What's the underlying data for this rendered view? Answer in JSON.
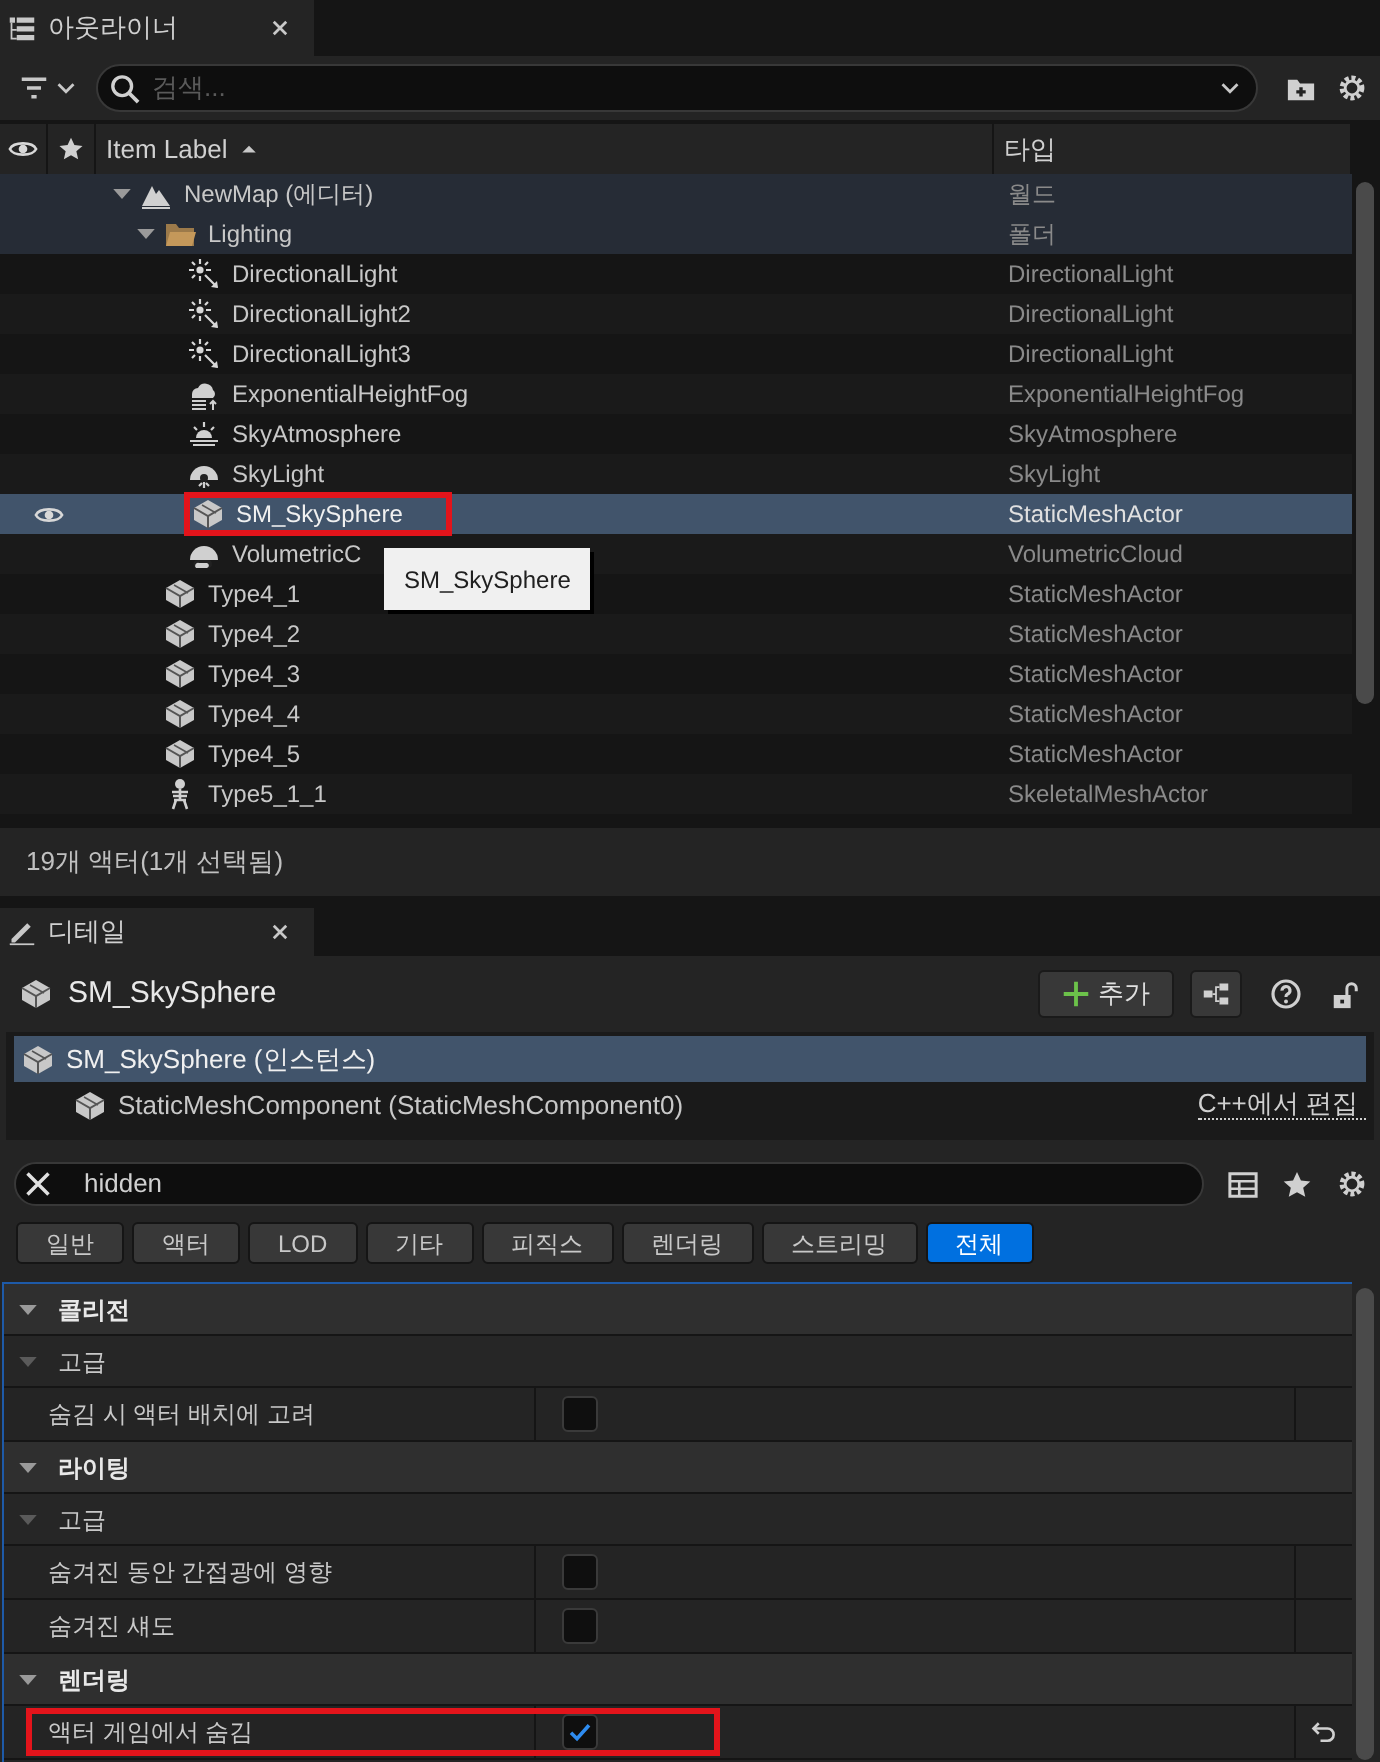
{
  "outliner": {
    "title": "아웃라이너",
    "search": {
      "placeholder": "검색..."
    },
    "columns": [
      "Item Label",
      "타입"
    ],
    "rows": [
      {
        "label": "NewMap (에디터)",
        "type": "월드",
        "kind": "world",
        "expanded": true,
        "selected": false,
        "highlighted": false,
        "children": [
          {
            "label": "Lighting",
            "type": "폴더",
            "kind": "folder",
            "expanded": true,
            "selected": false,
            "highlighted": false,
            "children": [
              {
                "label": "DirectionalLight",
                "type": "DirectionalLight",
                "kind": "light",
                "selected": false,
                "highlighted": false
              },
              {
                "label": "DirectionalLight2",
                "type": "DirectionalLight",
                "kind": "light",
                "selected": false,
                "highlighted": false
              },
              {
                "label": "DirectionalLight3",
                "type": "DirectionalLight",
                "kind": "light",
                "selected": false,
                "highlighted": false
              },
              {
                "label": "ExponentialHeightFog",
                "type": "ExponentialHeightFog",
                "kind": "fog",
                "selected": false,
                "highlighted": false
              },
              {
                "label": "SkyAtmosphere",
                "type": "SkyAtmosphere",
                "kind": "atmosphere",
                "selected": false,
                "highlighted": false
              },
              {
                "label": "SkyLight",
                "type": "SkyLight",
                "kind": "skylight",
                "selected": false,
                "highlighted": false
              },
              {
                "label": "SM_SkySphere",
                "type": "StaticMeshActor",
                "kind": "mesh",
                "selected": true,
                "highlighted": true
              },
              {
                "label": "VolumetricC",
                "type": "VolumetricCloud",
                "kind": "cloud",
                "selected": false,
                "highlighted": false
              }
            ]
          },
          {
            "label": "Type4_1",
            "type": "StaticMeshActor",
            "kind": "mesh",
            "selected": false,
            "highlighted": false
          },
          {
            "label": "Type4_2",
            "type": "StaticMeshActor",
            "kind": "mesh",
            "selected": false,
            "highlighted": false
          },
          {
            "label": "Type4_3",
            "type": "StaticMeshActor",
            "kind": "mesh",
            "selected": false,
            "highlighted": false
          },
          {
            "label": "Type4_4",
            "type": "StaticMeshActor",
            "kind": "mesh",
            "selected": false,
            "highlighted": false
          },
          {
            "label": "Type4_5",
            "type": "StaticMeshActor",
            "kind": "mesh",
            "selected": false,
            "highlighted": false
          },
          {
            "label": "Type5_1_1",
            "type": "SkeletalMeshActor",
            "kind": "skeleton",
            "selected": false,
            "highlighted": false
          }
        ]
      }
    ],
    "tooltip": "SM_SkySphere",
    "status": "19개 액터(1개 선택됨)"
  },
  "details": {
    "title": "디테일",
    "actor": "SM_SkySphere",
    "add_button": "추가",
    "components": [
      {
        "label": "SM_SkySphere (인스턴스)",
        "selected": true,
        "children": [
          {
            "label": "StaticMeshComponent (StaticMeshComponent0)",
            "selected": false
          }
        ]
      }
    ],
    "edit_link": "C++에서 편집",
    "search": {
      "value": "hidden"
    },
    "filters": [
      {
        "label": "일반",
        "selected": false
      },
      {
        "label": "액터",
        "selected": false
      },
      {
        "label": "LOD",
        "selected": false
      },
      {
        "label": "기타",
        "selected": false
      },
      {
        "label": "피직스",
        "selected": false
      },
      {
        "label": "렌더링",
        "selected": false
      },
      {
        "label": "스트리밍",
        "selected": false
      },
      {
        "label": "전체",
        "selected": true
      }
    ],
    "properties": [
      {
        "label": "콜리전",
        "kind": "category",
        "expanded": true,
        "children": [
          {
            "label": "고급",
            "kind": "subcategory",
            "expanded": true,
            "children": [
              {
                "label": "숨김 시 액터 배치에 고려",
                "kind": "checkbox",
                "checked": false,
                "modified": false,
                "highlighted": false
              }
            ]
          }
        ]
      },
      {
        "label": "라이팅",
        "kind": "category",
        "expanded": true,
        "children": [
          {
            "label": "고급",
            "kind": "subcategory",
            "expanded": true,
            "children": [
              {
                "label": "숨겨진 동안 간접광에 영향",
                "kind": "checkbox",
                "checked": false,
                "modified": false,
                "highlighted": false
              },
              {
                "label": "숨겨진 섀도",
                "kind": "checkbox",
                "checked": false,
                "modified": false,
                "highlighted": false
              }
            ]
          }
        ]
      },
      {
        "label": "렌더링",
        "kind": "category",
        "expanded": true,
        "children": [
          {
            "label": "액터 게임에서 숨김",
            "kind": "checkbox",
            "checked": true,
            "modified": true,
            "highlighted": true
          }
        ]
      }
    ]
  }
}
